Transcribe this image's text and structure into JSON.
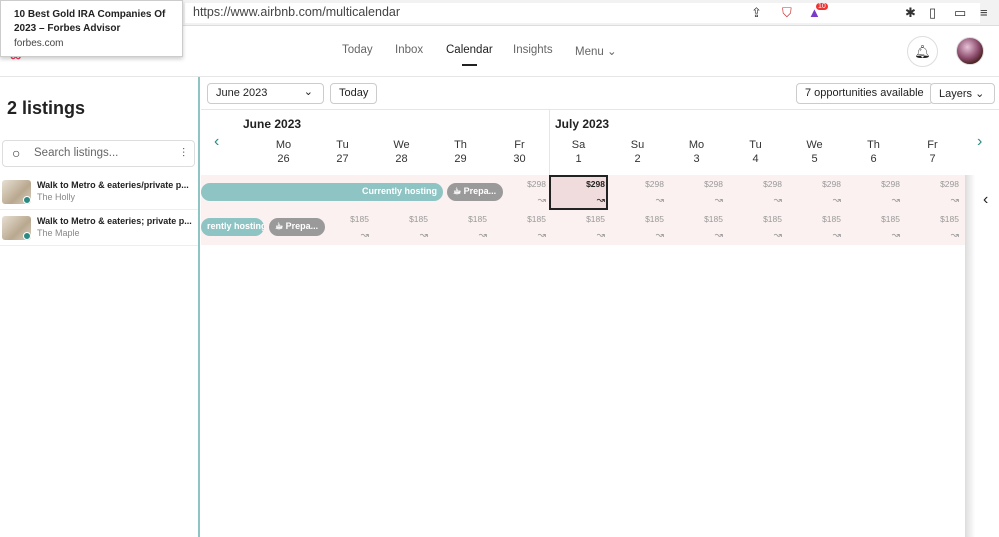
{
  "browser": {
    "url": "https://www.airbnb.com/multicalendar",
    "badge": "10"
  },
  "tooltip": {
    "title": "10 Best Gold IRA Companies Of 2023 – Forbes Advisor",
    "domain": "forbes.com"
  },
  "nav": {
    "items": [
      "Today",
      "Inbox",
      "Calendar",
      "Insights",
      "Menu"
    ],
    "active": "Calendar"
  },
  "sidebar": {
    "count": "2 listings",
    "search_placeholder": "Search listings...",
    "listings": [
      {
        "title": "Walk to Metro & eateries/private p...",
        "name": "The Holly"
      },
      {
        "title": "Walk to Metro & eateries; private p...",
        "name": "The Maple"
      }
    ]
  },
  "toolbar": {
    "month_select": "June 2023",
    "today": "Today",
    "opportunities": "7 opportunities available",
    "layers": "Layers"
  },
  "calendar": {
    "months": [
      "June 2023",
      "July 2023"
    ],
    "days": [
      {
        "d": "Mo",
        "n": "26"
      },
      {
        "d": "Tu",
        "n": "27"
      },
      {
        "d": "We",
        "n": "28"
      },
      {
        "d": "Th",
        "n": "29"
      },
      {
        "d": "Fr",
        "n": "30"
      },
      {
        "d": "Sa",
        "n": "1"
      },
      {
        "d": "Su",
        "n": "2"
      },
      {
        "d": "Mo",
        "n": "3"
      },
      {
        "d": "Tu",
        "n": "4"
      },
      {
        "d": "We",
        "n": "5"
      },
      {
        "d": "Th",
        "n": "6"
      },
      {
        "d": "Fr",
        "n": "7"
      }
    ],
    "rows": [
      {
        "hosting": "Currently hosting",
        "prep": "Prepa...",
        "price": "$298",
        "price_from": 4
      },
      {
        "hosting": "rently hosting",
        "prep": "Prepa...",
        "price": "$185",
        "price_from": 1
      }
    ],
    "selected_day": 5
  },
  "colors": {
    "accent": "#8fc4c4",
    "row_bg": "#fcf1f1",
    "brand": "#ff385c"
  }
}
